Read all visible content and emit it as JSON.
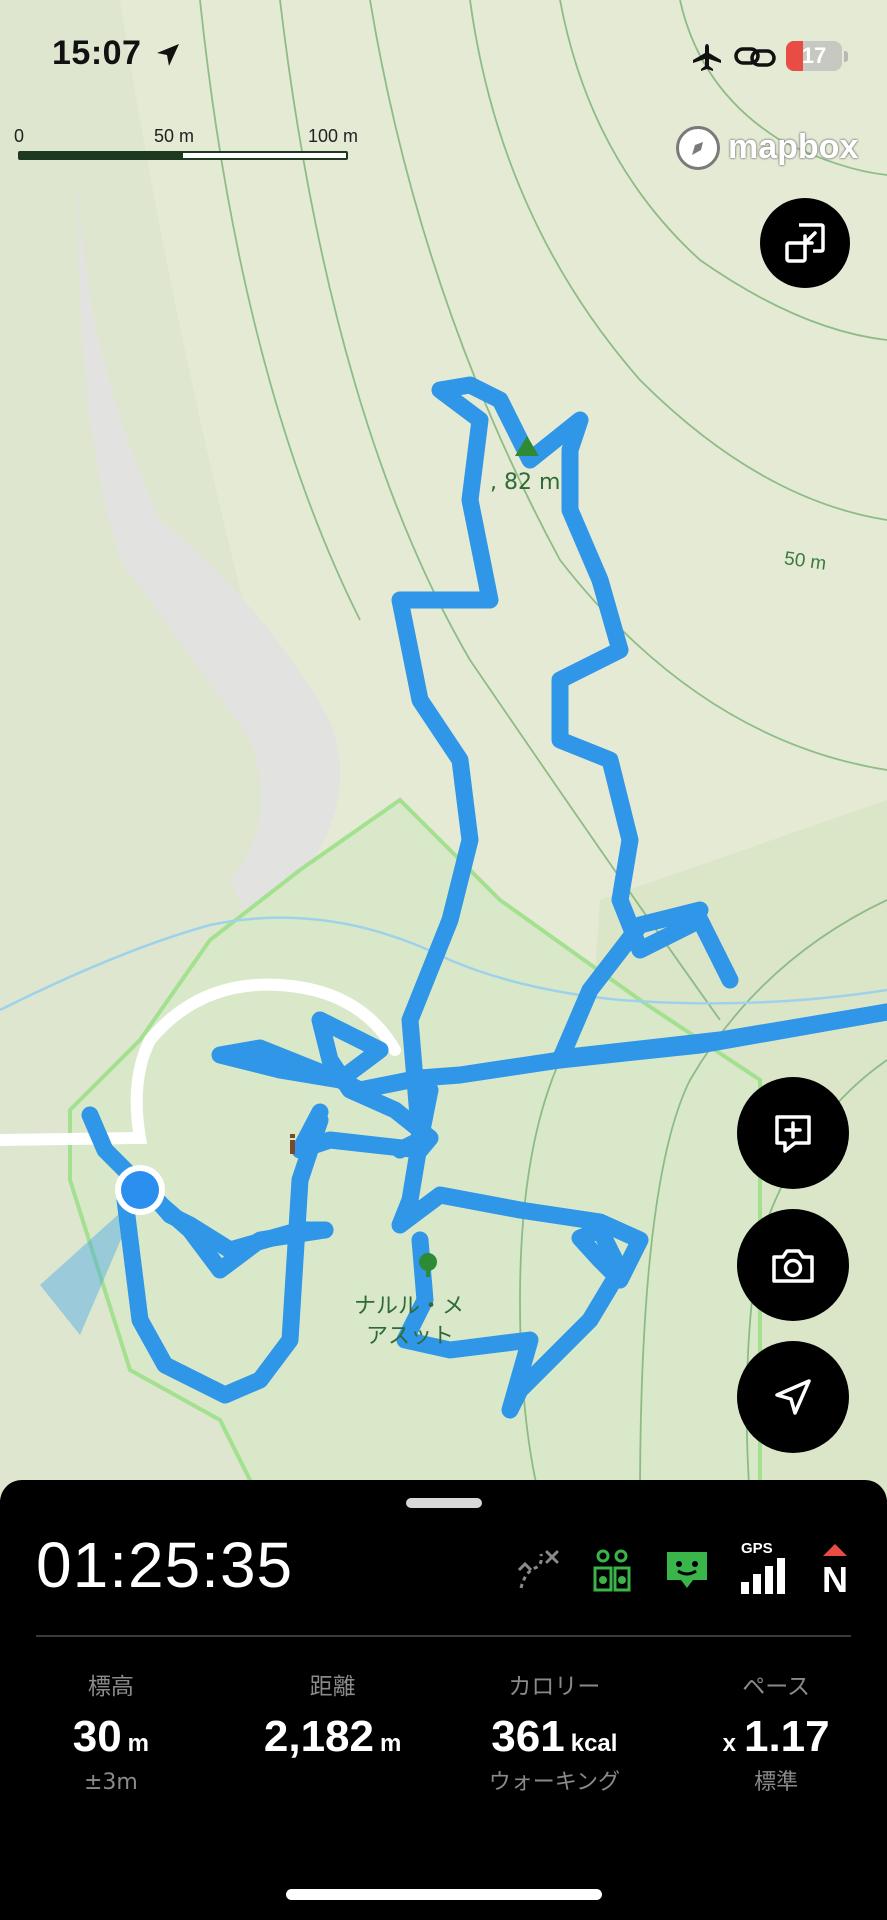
{
  "status_bar": {
    "time": "15:07",
    "location_icon": "location-arrow-icon",
    "airplane_icon": "airplane-mode-icon",
    "link_icon": "personal-hotspot-link-icon",
    "battery_level": "17",
    "battery_fraction": 0.17,
    "battery_color": "#e94c42"
  },
  "map": {
    "scale": {
      "labels": [
        "0",
        "50 m",
        "100 m"
      ]
    },
    "attribution": "mapbox",
    "contour_label": "50 m",
    "peak_label": ", 82 m",
    "poi_label_line1": "ナルル・メ",
    "poi_label_line2": "アスット",
    "info_icon": "info-icon",
    "peak_icon": "mountain-peak-icon",
    "tree_icon": "tree-icon",
    "colors": {
      "map_base": "#e4ead4",
      "park_fill": "#d9e8c9",
      "park_border": "#a3e08f",
      "track": "#2f96e8",
      "contour": "#7fb57a",
      "water": "#9fd2ea",
      "road": "#ffffff",
      "location_dot": "#2b8ff0"
    }
  },
  "map_buttons": {
    "fullscreen_icon": "exit-fullscreen-icon",
    "add_note_icon": "add-note-icon",
    "camera_icon": "camera-icon",
    "navigate_icon": "navigation-arrow-icon"
  },
  "panel": {
    "elapsed_time": "01:25:35",
    "icons": [
      "route-off-icon",
      "compass-pins-icon",
      "talk-bubble-icon",
      "gps-signal-icon",
      "north-compass-icon"
    ],
    "gps_label": "GPS",
    "north_label": "N",
    "stats": [
      {
        "label": "標高",
        "value": "30",
        "unit": "m",
        "sub": "±3m"
      },
      {
        "label": "距離",
        "value": "2,182",
        "unit": "m",
        "sub": ""
      },
      {
        "label": "カロリー",
        "value": "361",
        "unit": "kcal",
        "sub": "ウォーキング"
      },
      {
        "label": "ペース",
        "prefix": "x",
        "value": "1.17",
        "unit": "",
        "sub": "標準"
      }
    ]
  }
}
